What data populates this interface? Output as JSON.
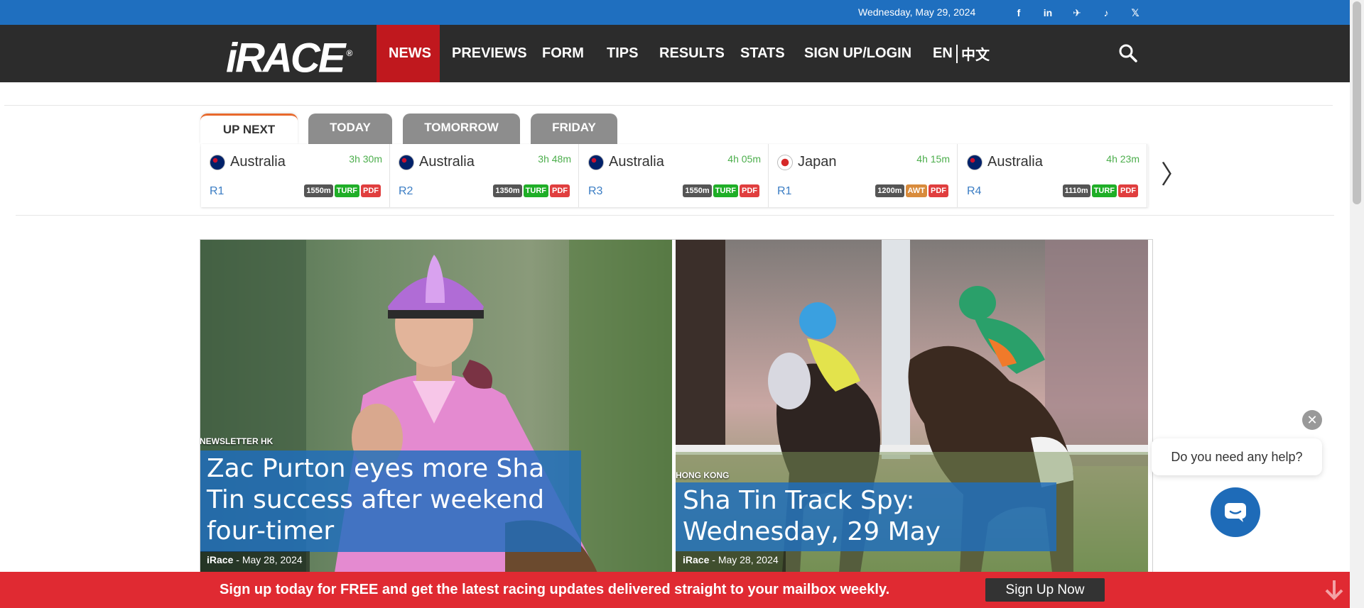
{
  "topbar": {
    "date": "Wednesday, May 29, 2024",
    "social_icons": [
      "facebook-icon",
      "linkedin-icon",
      "telegram-icon",
      "tiktok-icon",
      "x-icon"
    ],
    "social_glyphs": [
      "f",
      "in",
      "✈",
      "♪",
      "𝕏"
    ]
  },
  "nav": {
    "logo": "iRACE",
    "logo_mark": "®",
    "items": [
      "NEWS",
      "PREVIEWS",
      "FORM",
      "TIPS",
      "RESULTS",
      "STATS",
      "SIGN UP/LOGIN"
    ],
    "active": "NEWS",
    "lang_en": "EN",
    "lang_zh": "中文"
  },
  "race_tabs": [
    "UP NEXT",
    "TODAY",
    "TOMORROW",
    "FRIDAY"
  ],
  "races": [
    {
      "country": "Australia",
      "flag": "australia-flag-icon",
      "time": "3h 30m",
      "race": "R1",
      "distance": "1550m",
      "surface": "TURF",
      "pdf": "PDF"
    },
    {
      "country": "Australia",
      "flag": "australia-flag-icon",
      "time": "3h 48m",
      "race": "R2",
      "distance": "1350m",
      "surface": "TURF",
      "pdf": "PDF"
    },
    {
      "country": "Australia",
      "flag": "australia-flag-icon",
      "time": "4h 05m",
      "race": "R3",
      "distance": "1550m",
      "surface": "TURF",
      "pdf": "PDF"
    },
    {
      "country": "Japan",
      "flag": "japan-flag-icon",
      "time": "4h 15m",
      "race": "R1",
      "distance": "1200m",
      "surface": "AWT",
      "pdf": "PDF"
    },
    {
      "country": "Australia",
      "flag": "australia-flag-icon",
      "time": "4h 23m",
      "race": "R4",
      "distance": "1110m",
      "surface": "TURF",
      "pdf": "PDF"
    }
  ],
  "strip_next_glyph": "〉",
  "news": [
    {
      "category": "NEWSLETTER HK",
      "title": "Zac Purton eyes more Sha Tin success after weekend four-timer",
      "author": "iRace",
      "date": "May 28, 2024"
    },
    {
      "category": "HONG KONG",
      "title": "Sha Tin Track Spy: Wednesday, 29 May",
      "author": "iRace",
      "date": "May 28, 2024"
    }
  ],
  "meta_separator": "-",
  "chat": {
    "prompt": "Do you need any help?",
    "close_glyph": "✕"
  },
  "signup": {
    "text": "Sign up today for FREE and get the latest racing updates delivered straight to your mailbox weekly.",
    "button": "Sign Up Now"
  },
  "colors": {
    "topbar": "#1f6fbf",
    "navbar": "#2c2c2c",
    "nav_active": "#c0181e",
    "signup_banner": "#e02a32",
    "chat_button": "#1e6bb8",
    "tab_accent": "#e8692c"
  }
}
